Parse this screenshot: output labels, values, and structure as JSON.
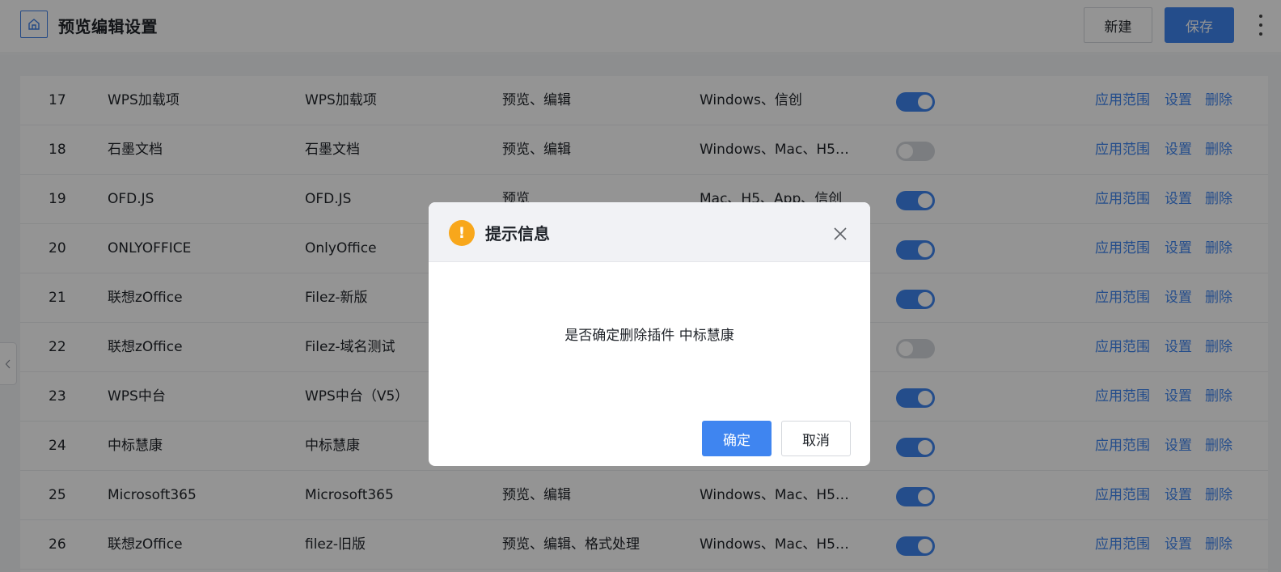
{
  "header": {
    "title": "预览编辑设置",
    "new_label": "新建",
    "save_label": "保存"
  },
  "table": {
    "rows": [
      {
        "num": "17",
        "name": "WPS加载项",
        "plugin": "WPS加载项",
        "capability": "预览、编辑",
        "platform": "Windows、信创",
        "enabled": true
      },
      {
        "num": "18",
        "name": "石墨文档",
        "plugin": "石墨文档",
        "capability": "预览、编辑",
        "platform": "Windows、Mac、H5、…",
        "enabled": false
      },
      {
        "num": "19",
        "name": "OFD.JS",
        "plugin": "OFD.JS",
        "capability": "预览",
        "platform": "Mac、H5、App、信创",
        "enabled": true
      },
      {
        "num": "20",
        "name": "ONLYOFFICE",
        "plugin": "OnlyOffice",
        "capability": "",
        "platform": "",
        "enabled": true
      },
      {
        "num": "21",
        "name": "联想zOffice",
        "plugin": "Filez-新版",
        "capability": "",
        "platform": "",
        "enabled": true
      },
      {
        "num": "22",
        "name": "联想zOffice",
        "plugin": "Filez-域名测试",
        "capability": "",
        "platform": "",
        "enabled": false
      },
      {
        "num": "23",
        "name": "WPS中台",
        "plugin": "WPS中台（V5）",
        "capability": "",
        "platform": "",
        "enabled": true
      },
      {
        "num": "24",
        "name": "中标慧康",
        "plugin": "中标慧康",
        "capability": "",
        "platform": "",
        "enabled": true
      },
      {
        "num": "25",
        "name": "Microsoft365",
        "plugin": "Microsoft365",
        "capability": "预览、编辑",
        "platform": "Windows、Mac、H5、…",
        "enabled": true
      },
      {
        "num": "26",
        "name": "联想zOffice",
        "plugin": "filez-旧版",
        "capability": "预览、编辑、格式处理",
        "platform": "Windows、Mac、H5、…",
        "enabled": true
      }
    ],
    "actions": {
      "scope": "应用范围",
      "settings": "设置",
      "delete": "删除"
    }
  },
  "dialog": {
    "title": "提示信息",
    "icon": "!",
    "message": "是否确定删除插件 中标慧康",
    "ok_label": "确定",
    "cancel_label": "取消"
  },
  "colors": {
    "accent": "#3f85f0",
    "warning": "#f8a71b",
    "toggle_off": "#d4d7dc"
  }
}
